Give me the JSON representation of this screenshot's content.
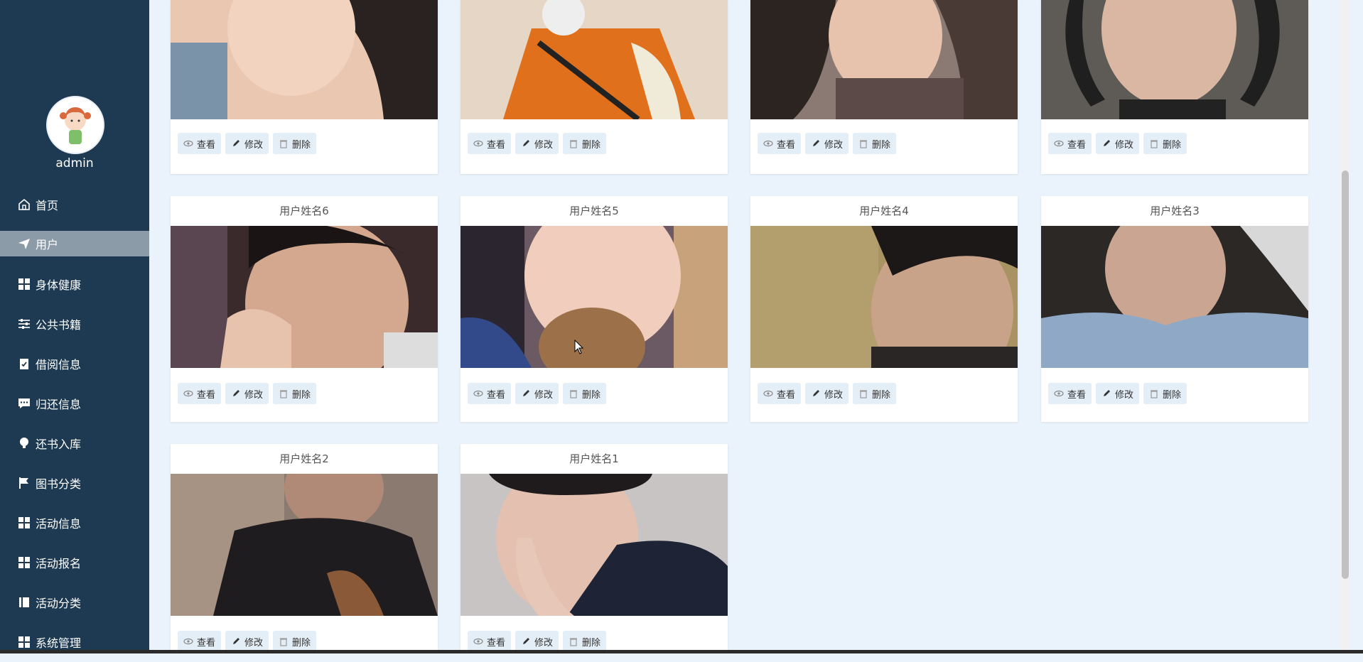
{
  "sidebar": {
    "username": "admin",
    "items": [
      {
        "label": "首页",
        "icon": "home-icon"
      },
      {
        "label": "用户",
        "icon": "send-icon",
        "active": true
      },
      {
        "label": "身体健康",
        "icon": "grid-icon"
      },
      {
        "label": "公共书籍",
        "icon": "sliders-icon"
      },
      {
        "label": "借阅信息",
        "icon": "clipboard-check-icon"
      },
      {
        "label": "归还信息",
        "icon": "comment-icon"
      },
      {
        "label": "还书入库",
        "icon": "lightbulb-icon"
      },
      {
        "label": "图书分类",
        "icon": "flag-icon"
      },
      {
        "label": "活动信息",
        "icon": "grid-icon"
      },
      {
        "label": "活动报名",
        "icon": "grid-icon"
      },
      {
        "label": "活动分类",
        "icon": "book-icon"
      },
      {
        "label": "系统管理",
        "icon": "grid-icon"
      }
    ]
  },
  "actions": {
    "view": "查看",
    "edit": "修改",
    "delete": "删除"
  },
  "cards": [
    {
      "title": ""
    },
    {
      "title": ""
    },
    {
      "title": ""
    },
    {
      "title": ""
    },
    {
      "title": "用户姓名6"
    },
    {
      "title": "用户姓名5"
    },
    {
      "title": "用户姓名4"
    },
    {
      "title": "用户姓名3"
    },
    {
      "title": "用户姓名2"
    },
    {
      "title": "用户姓名1"
    }
  ],
  "colors": {
    "sidebar": "#1d3a52",
    "active": "#8c9ba8",
    "background": "#eaf2fb",
    "button": "#e4eef7"
  }
}
